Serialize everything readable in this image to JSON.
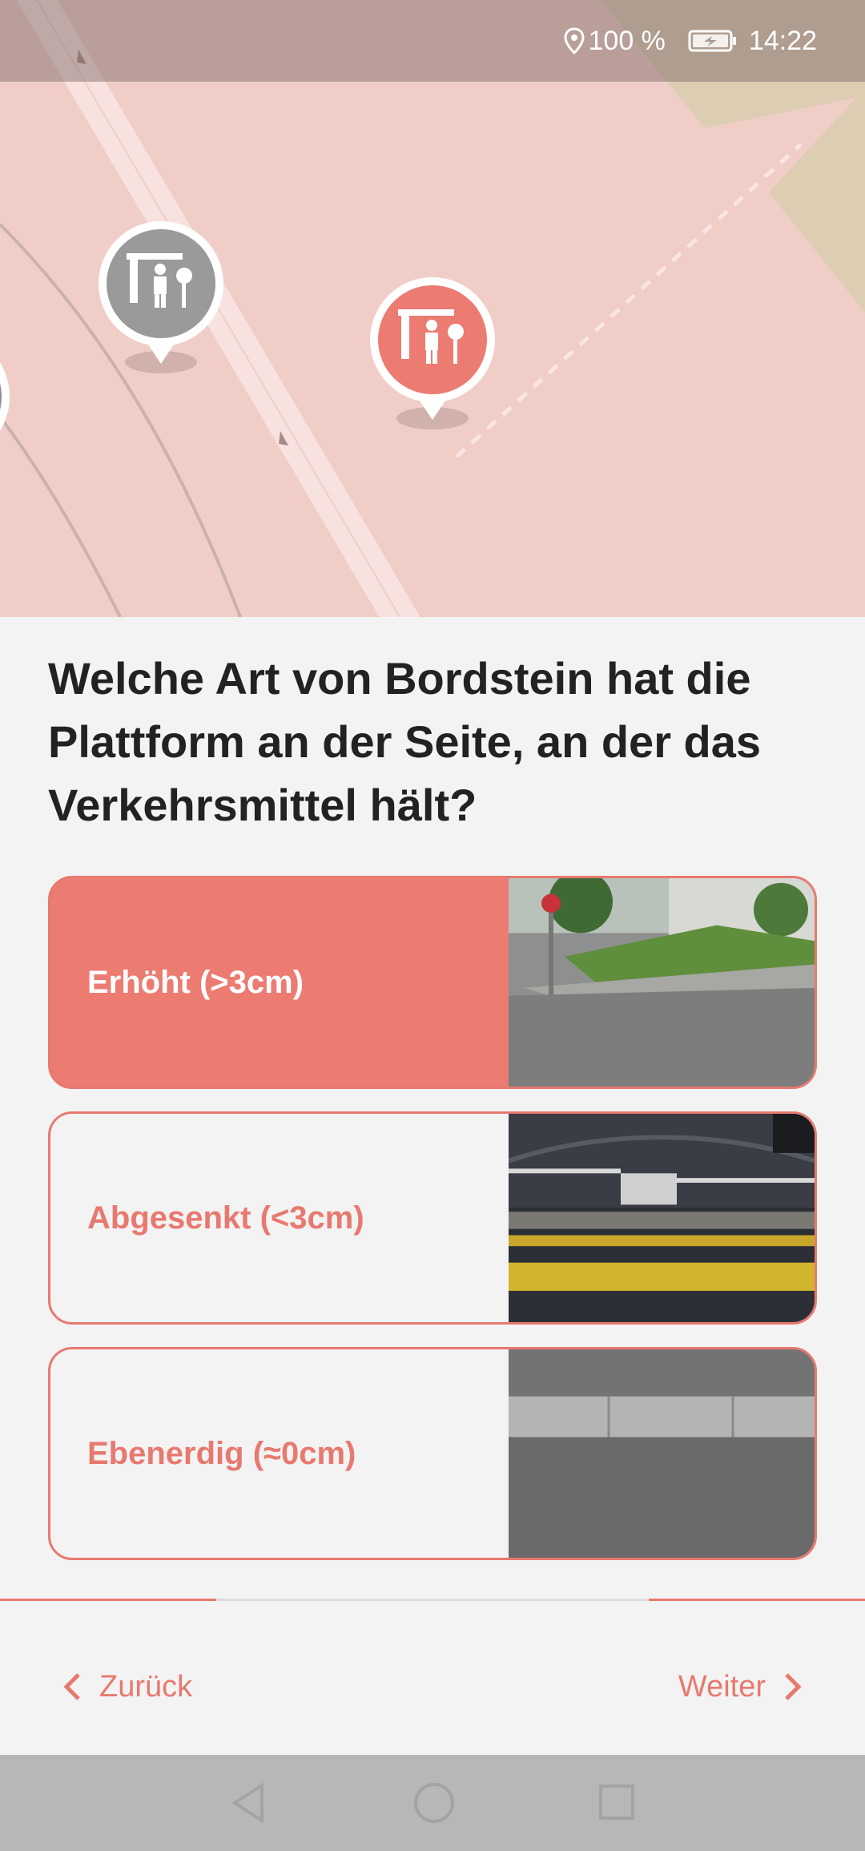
{
  "status_bar": {
    "battery": "100 %",
    "time": "14:22",
    "icons": [
      "location-icon",
      "battery-charging-icon"
    ]
  },
  "map": {
    "pins": [
      {
        "name": "bus-stop-pin-neighbour",
        "state": "inactive",
        "color": "#8f8f8f"
      },
      {
        "name": "bus-stop-pin-current",
        "state": "active",
        "color": "#ec7b71"
      },
      {
        "name": "bus-stop-pin-edge",
        "state": "inactive",
        "color": "#8f8f8f"
      }
    ]
  },
  "question": "Welche Art von Bordstein hat die Plattform an der Seite, an der das Verkehrsmittel hält?",
  "options": [
    {
      "label": "Erhöht (>3cm)",
      "selected": true
    },
    {
      "label": "Abgesenkt (<3cm)",
      "selected": false
    },
    {
      "label": "Ebenerdig (≈0cm)",
      "selected": false
    }
  ],
  "navigation": {
    "back_label": "Zurück",
    "next_label": "Weiter"
  },
  "colors": {
    "accent": "#ec7b71",
    "map_background": "#f0cec7",
    "panel_background": "#f3f3f3"
  }
}
